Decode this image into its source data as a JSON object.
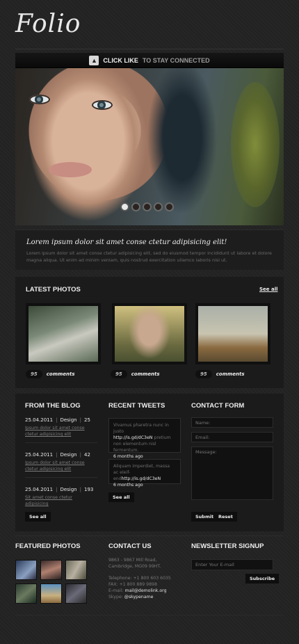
{
  "logo": "Folio",
  "likebar": {
    "strong": "CLICK LIKE",
    "light": "TO STAY CONNECTED"
  },
  "slider": {
    "dots": 5,
    "active_index": 0
  },
  "intro": {
    "title": "Lorem ipsum dolor sit amet conse ctetur adipisicing elit!",
    "text": "Lorem ipsum dolor sit amet conse ctetur adipisicing elit, sed do eiusmod tempor incididunt ut labore et dolore magna aliqua. Ut enim ad minim veniam, quis nostrud exercitation ullamco laboris nisi ut."
  },
  "latest_photos": {
    "heading": "LATEST PHOTOS",
    "see_all": "See all",
    "items": [
      {
        "count": "95",
        "label": "comments"
      },
      {
        "count": "95",
        "label": "comments"
      },
      {
        "count": "95",
        "label": "comments"
      }
    ]
  },
  "blog": {
    "heading": "FROM THE BLOG",
    "posts": [
      {
        "date": "25.04.2011",
        "category": "Design",
        "count": "25",
        "link": "Ipsum dolor sit amet conse ctetur adipisicing elit"
      },
      {
        "date": "25.04.2011",
        "category": "Design",
        "count": "42",
        "link": "Ipsum dolor sit amet conse ctetur adipisicing elit"
      },
      {
        "date": "25.04.2011",
        "category": "Design",
        "count": "193",
        "link": "Sit amet conse ctetur adipisicing"
      }
    ],
    "see_all": "See all"
  },
  "tweets": {
    "heading": "RECENT TWEETS",
    "items": [
      {
        "text": "Vivamus pharetra nunc in justo",
        "link": "http://is.gd/dC3eN",
        "rest": "pretium non elementum nisl fermentum.",
        "time": "6 months ago"
      },
      {
        "text": "Aliquam imperdiet, massa ac eleif-end",
        "link": "http://is.gd/dC3eN",
        "rest": "",
        "time": "6 months ago"
      }
    ],
    "see_all": "See all"
  },
  "contact_form": {
    "heading": "CONTACT FORM",
    "name_placeholder": "Name:",
    "email_placeholder": "Email:",
    "message_placeholder": "Message:",
    "submit": "Submit",
    "reset": "Reset"
  },
  "featured": {
    "heading": "FEATURED PHOTOS",
    "count": 6
  },
  "contact_us": {
    "heading": "CONTACT US",
    "address1": "9863 - 9867 Mill Road,",
    "address2": "Cambridge, MG09 99HT.",
    "telephone_label": "Telephone:",
    "telephone": "+1 800 603 6035",
    "fax_label": "FAX:",
    "fax": "+1 800 889 9898",
    "email_label": "E-mail:",
    "email": "mail@demolink.org",
    "skype_label": "Skype:",
    "skype": "@skypename"
  },
  "newsletter": {
    "heading": "NEWSLETTER SIGNUP",
    "placeholder": "Enter Your E-mail",
    "subscribe": "Subscribe"
  }
}
